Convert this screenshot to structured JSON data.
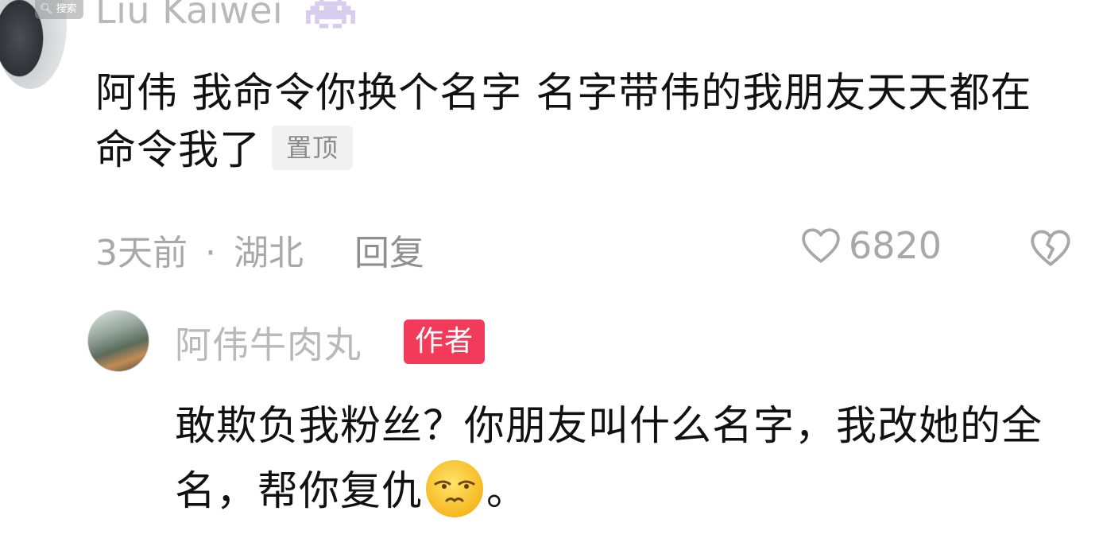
{
  "top_comment": {
    "search_chip": "搜索",
    "username": "Liu Kaiwei",
    "badge_icon": "alien-icon",
    "text": "阿伟 我命令你换个名字 名字带伟的我朋友天天都在命令我了",
    "pin_label": "置顶",
    "time": "3天前",
    "separator": "·",
    "location": "湖北",
    "reply_label": "回复",
    "like_count": "6820"
  },
  "reply_comment": {
    "username": "阿伟牛肉丸",
    "author_badge": "作者",
    "text_before_emoji": "敢欺负我粉丝？你朋友叫什么名字，我改她的全名，帮你复仇",
    "emoji": "smirk-emoji",
    "text_after_emoji": "。"
  },
  "colors": {
    "author_badge_bg": "#f23a5a",
    "muted_text": "#a8a8a8",
    "body_text": "#111111"
  }
}
